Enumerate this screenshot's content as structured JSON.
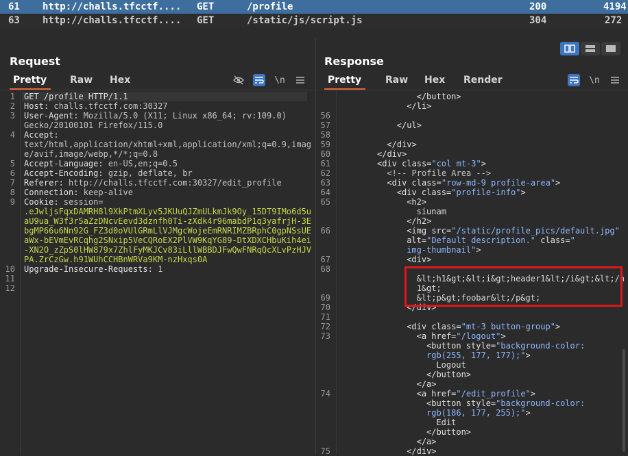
{
  "history": {
    "rows": [
      {
        "id": "61",
        "host": "http://challs.tfcctf....",
        "method": "GET",
        "path": "/profile",
        "status": "200",
        "length": "4194",
        "selected": true
      },
      {
        "id": "63",
        "host": "http://challs.tfcctf....",
        "method": "GET",
        "path": "/static/js/script.js",
        "status": "304",
        "length": "272",
        "selected": false
      }
    ]
  },
  "request": {
    "title": "Request",
    "tabs": [
      "Pretty",
      "Raw",
      "Hex"
    ],
    "active_tab": "Pretty",
    "tools": {
      "hide_icon": "eye-slash-icon",
      "wrap_icon": "wrap-icon",
      "newline_label": "\\n",
      "menu_icon": "hamburger-icon"
    },
    "lines": [
      {
        "n": "1",
        "parts": [
          {
            "t": "GET /profile HTTP/1.1",
            "c": "hdrname"
          }
        ]
      },
      {
        "n": "2",
        "parts": [
          {
            "t": "Host: ",
            "c": "hdrname"
          },
          {
            "t": "challs.tfcctf.com:30327",
            "c": "hdrval"
          }
        ]
      },
      {
        "n": "3",
        "parts": [
          {
            "t": "User-Agent: ",
            "c": "hdrname"
          },
          {
            "t": "Mozilla/5.0 (X11; Linux x86_64; rv:109.0)",
            "c": "hdrval"
          }
        ]
      },
      {
        "n": "",
        "parts": [
          {
            "t": "Gecko/20100101 Firefox/115.0",
            "c": "hdrval"
          }
        ]
      },
      {
        "n": "4",
        "parts": [
          {
            "t": "Accept: ",
            "c": "hdrname"
          }
        ]
      },
      {
        "n": "",
        "parts": [
          {
            "t": "text/html,application/xhtml+xml,application/xml;q=0.9,imag",
            "c": "hdrval"
          }
        ]
      },
      {
        "n": "",
        "parts": [
          {
            "t": "e/avif,image/webp,*/*;q=0.8",
            "c": "hdrval"
          }
        ]
      },
      {
        "n": "5",
        "parts": [
          {
            "t": "Accept-Language: ",
            "c": "hdrname"
          },
          {
            "t": "en-US,en;q=0.5",
            "c": "hdrval"
          }
        ]
      },
      {
        "n": "6",
        "parts": [
          {
            "t": "Accept-Encoding: ",
            "c": "hdrname"
          },
          {
            "t": "gzip, deflate, br",
            "c": "hdrval"
          }
        ]
      },
      {
        "n": "7",
        "parts": [
          {
            "t": "Referer: ",
            "c": "hdrname"
          },
          {
            "t": "http://challs.tfcctf.com:30327/edit_profile",
            "c": "hdrval"
          }
        ]
      },
      {
        "n": "8",
        "parts": [
          {
            "t": "Connection: ",
            "c": "hdrname"
          },
          {
            "t": "keep-alive",
            "c": "hdrval"
          }
        ]
      },
      {
        "n": "9",
        "parts": [
          {
            "t": "Cookie: ",
            "c": "hdrname"
          },
          {
            "t": "session=",
            "c": "hdrval"
          }
        ]
      },
      {
        "n": "",
        "parts": [
          {
            "t": ".eJwljsFqxDAMRH8l9XkPtmXLyv5JKUuQJZmULkmJk9Oy_15DT9IMo6d5u",
            "c": "cookie"
          }
        ]
      },
      {
        "n": "",
        "parts": [
          {
            "t": "aU9ua_W3f3r5aZzDNcvEevd3dznfh0Ti-zXdk4r96mabdP1q3yafrjH-3E",
            "c": "cookie"
          }
        ]
      },
      {
        "n": "",
        "parts": [
          {
            "t": "bgMP66u6Nn92G_FZ3d0oVUlGRmLlVJMgcWojeEmRNRIMZBRphC0gpNSsUE",
            "c": "cookie"
          }
        ]
      },
      {
        "n": "",
        "parts": [
          {
            "t": "aWx-bEVmEvRCqhg2SNxip5VeCQRoEX2PlVW9KqYG89-DtXDXCHbuKih4ei",
            "c": "cookie"
          }
        ]
      },
      {
        "n": "",
        "parts": [
          {
            "t": "-XN2O_zZpS0lHW879x7ZhlFyMKJCv83iLllWBBDJFwQwFNRqQcXLvPzHJV",
            "c": "cookie"
          }
        ]
      },
      {
        "n": "",
        "parts": [
          {
            "t": "PA.ZrCzGw.h91WUhCCHBnWRVa9KM-nzHxqs0A",
            "c": "cookie"
          }
        ]
      },
      {
        "n": "10",
        "parts": [
          {
            "t": "Upgrade-Insecure-Requests: ",
            "c": "hdrname"
          },
          {
            "t": "1",
            "c": "hdrval"
          }
        ]
      },
      {
        "n": "11",
        "parts": []
      },
      {
        "n": "12",
        "parts": []
      }
    ]
  },
  "response": {
    "title": "Response",
    "tabs": [
      "Pretty",
      "Raw",
      "Hex",
      "Render"
    ],
    "active_tab": "Pretty",
    "tools": {
      "wrap_icon": "wrap-icon",
      "newline_label": "\\n",
      "menu_icon": "hamburger-icon"
    },
    "layout_toggle_icons": [
      "split-vertical-icon",
      "split-horizontal-icon",
      "single-pane-icon"
    ],
    "lines": [
      {
        "n": "",
        "i": 8,
        "parts": [
          {
            "t": "</button>",
            "c": "tag"
          }
        ]
      },
      {
        "n": "",
        "i": 6,
        "parts": [
          {
            "t": "</li>",
            "c": "tag"
          }
        ]
      },
      {
        "n": "56",
        "i": 0,
        "parts": []
      },
      {
        "n": "57",
        "i": 4,
        "parts": [
          {
            "t": "</ul>",
            "c": "tag"
          }
        ]
      },
      {
        "n": "58",
        "i": 0,
        "parts": []
      },
      {
        "n": "59",
        "i": 2,
        "parts": [
          {
            "t": "</div>",
            "c": "tag"
          }
        ]
      },
      {
        "n": "60",
        "i": 0,
        "parts": [
          {
            "t": "</div>",
            "c": "tag"
          }
        ]
      },
      {
        "n": "61",
        "i": 0,
        "parts": [
          {
            "t": "<div ",
            "c": "tag"
          },
          {
            "t": "class=",
            "c": "attr"
          },
          {
            "t": "\"col mt-3\"",
            "c": "aval"
          },
          {
            "t": ">",
            "c": "tag"
          }
        ]
      },
      {
        "n": "62",
        "i": 2,
        "parts": [
          {
            "t": "<!-- Profile Area -->",
            "c": "comment"
          }
        ]
      },
      {
        "n": "63",
        "i": 2,
        "parts": [
          {
            "t": "<div ",
            "c": "tag"
          },
          {
            "t": "class=",
            "c": "attr"
          },
          {
            "t": "\"row-md-9 profile-area\"",
            "c": "aval"
          },
          {
            "t": ">",
            "c": "tag"
          }
        ]
      },
      {
        "n": "64",
        "i": 4,
        "parts": [
          {
            "t": "<div ",
            "c": "tag"
          },
          {
            "t": "class=",
            "c": "attr"
          },
          {
            "t": "\"profile-info\"",
            "c": "aval"
          },
          {
            "t": ">",
            "c": "tag"
          }
        ]
      },
      {
        "n": "65",
        "i": 6,
        "parts": [
          {
            "t": "<h2>",
            "c": "tag"
          }
        ]
      },
      {
        "n": "",
        "i": 8,
        "parts": [
          {
            "t": "siunam",
            "c": "txt"
          }
        ]
      },
      {
        "n": "",
        "i": 6,
        "parts": [
          {
            "t": "</h2>",
            "c": "tag"
          }
        ]
      },
      {
        "n": "66",
        "i": 6,
        "parts": [
          {
            "t": "<img ",
            "c": "tag"
          },
          {
            "t": "src=",
            "c": "attr"
          },
          {
            "t": "\"/static/profile_pics/default.jpg\"",
            "c": "aval"
          }
        ]
      },
      {
        "n": "",
        "i": 6,
        "parts": [
          {
            "t": "alt=",
            "c": "attr"
          },
          {
            "t": "\"Default description.\"",
            "c": "aval"
          },
          {
            "t": " class=",
            "c": "attr"
          },
          {
            "t": "\"",
            "c": "aval"
          }
        ]
      },
      {
        "n": "",
        "i": 6,
        "parts": [
          {
            "t": "img-thumbnail\"",
            "c": "aval"
          },
          {
            "t": ">",
            "c": "tag"
          }
        ]
      },
      {
        "n": "67",
        "i": 6,
        "parts": [
          {
            "t": "<div>",
            "c": "tag"
          }
        ]
      },
      {
        "n": "68",
        "i": 0,
        "parts": []
      },
      {
        "n": "",
        "i": 8,
        "parts": [
          {
            "t": "&lt;h1&gt;&lt;i&gt;header1&lt;/i&gt;&lt;/h",
            "c": "txt"
          }
        ]
      },
      {
        "n": "",
        "i": 8,
        "parts": [
          {
            "t": "1&gt;",
            "c": "txt"
          }
        ]
      },
      {
        "n": "69",
        "i": 8,
        "parts": [
          {
            "t": "&lt;p&gt;foobar&lt;/p&gt;",
            "c": "txt"
          }
        ]
      },
      {
        "n": "70",
        "i": 6,
        "parts": [
          {
            "t": "</div>",
            "c": "tag"
          }
        ]
      },
      {
        "n": "71",
        "i": 0,
        "parts": []
      },
      {
        "n": "72",
        "i": 6,
        "parts": [
          {
            "t": "<div ",
            "c": "tag"
          },
          {
            "t": "class=",
            "c": "attr"
          },
          {
            "t": "\"mt-3 button-group\"",
            "c": "aval"
          },
          {
            "t": ">",
            "c": "tag"
          }
        ]
      },
      {
        "n": "73",
        "i": 8,
        "parts": [
          {
            "t": "<a ",
            "c": "tag"
          },
          {
            "t": "href=",
            "c": "attr"
          },
          {
            "t": "\"/logout\"",
            "c": "aval"
          },
          {
            "t": ">",
            "c": "tag"
          }
        ]
      },
      {
        "n": "",
        "i": 10,
        "parts": [
          {
            "t": "<button ",
            "c": "tag"
          },
          {
            "t": "style=",
            "c": "attr"
          },
          {
            "t": "\"background-color:",
            "c": "aval"
          }
        ]
      },
      {
        "n": "",
        "i": 10,
        "parts": [
          {
            "t": "rgb(255, 177, 177);\"",
            "c": "aval"
          },
          {
            "t": ">",
            "c": "tag"
          }
        ]
      },
      {
        "n": "",
        "i": 12,
        "parts": [
          {
            "t": "Logout",
            "c": "txt"
          }
        ]
      },
      {
        "n": "",
        "i": 10,
        "parts": [
          {
            "t": "</button>",
            "c": "tag"
          }
        ]
      },
      {
        "n": "",
        "i": 8,
        "parts": [
          {
            "t": "</a>",
            "c": "tag"
          }
        ]
      },
      {
        "n": "74",
        "i": 8,
        "parts": [
          {
            "t": "<a ",
            "c": "tag"
          },
          {
            "t": "href=",
            "c": "attr"
          },
          {
            "t": "\"/edit_profile\"",
            "c": "aval"
          },
          {
            "t": ">",
            "c": "tag"
          }
        ]
      },
      {
        "n": "",
        "i": 10,
        "parts": [
          {
            "t": "<button ",
            "c": "tag"
          },
          {
            "t": "style=",
            "c": "attr"
          },
          {
            "t": "\"background-color:",
            "c": "aval"
          }
        ]
      },
      {
        "n": "",
        "i": 10,
        "parts": [
          {
            "t": "rgb(186, 177, 255);\"",
            "c": "aval"
          },
          {
            "t": ">",
            "c": "tag"
          }
        ]
      },
      {
        "n": "",
        "i": 12,
        "parts": [
          {
            "t": "Edit",
            "c": "txt"
          }
        ]
      },
      {
        "n": "",
        "i": 10,
        "parts": [
          {
            "t": "</button>",
            "c": "tag"
          }
        ]
      },
      {
        "n": "",
        "i": 8,
        "parts": [
          {
            "t": "</a>",
            "c": "tag"
          }
        ]
      },
      {
        "n": "75",
        "i": 6,
        "parts": [
          {
            "t": "</div>",
            "c": "tag"
          }
        ]
      }
    ]
  },
  "colors": {
    "accent": "#e8643a",
    "selection": "#3d6e9e",
    "highlight_box": "#e0161a",
    "toggle_on": "#3d75c2"
  }
}
